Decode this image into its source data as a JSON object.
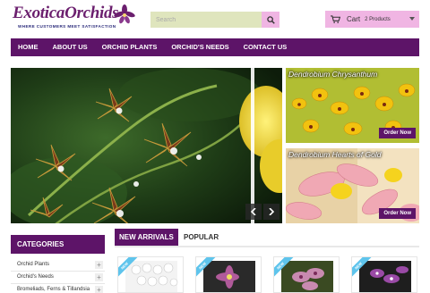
{
  "header": {
    "logo_text": "ExoticaOrchids",
    "logo_tagline": "WHERE CUSTOMERS MEET SATISFACTION",
    "search_placeholder": "Search",
    "cart_label": "Cart",
    "cart_count": "2 Products"
  },
  "nav": {
    "items": [
      "HOME",
      "ABOUT US",
      "ORCHID PLANTS",
      "ORCHID'S NEEDS",
      "CONTACT US"
    ]
  },
  "promos": [
    {
      "title": "Dendrobium Chrysanthum",
      "button": "Order Now"
    },
    {
      "title": "Dendrobium Hearts of Gold",
      "button": "Order Now"
    }
  ],
  "sidebar": {
    "title": "CATEGORIES",
    "items": [
      "Orchid Plants",
      "Orchid's Needs",
      "Bromeliads, Ferns & Tillandsia"
    ]
  },
  "tabs": {
    "active": "NEW ARRIVALS",
    "inactive": "POPULAR"
  },
  "products": {
    "ribbon": "NEW"
  },
  "colors": {
    "brand_purple": "#5d1468",
    "search_bg": "#dfe5bd",
    "accent_pink": "#f0b5e3",
    "ribbon_blue": "#5ec4ec"
  }
}
